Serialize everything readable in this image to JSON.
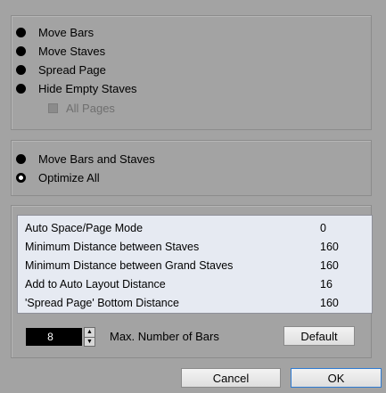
{
  "layout_options": [
    {
      "label": "Move Bars",
      "selected": true
    },
    {
      "label": "Move Staves",
      "selected": true
    },
    {
      "label": "Spread Page",
      "selected": true
    },
    {
      "label": "Hide Empty Staves",
      "selected": true
    }
  ],
  "all_pages": {
    "label": "All Pages",
    "checked": false,
    "enabled": false
  },
  "mode_options": [
    {
      "label": "Move Bars and Staves",
      "selected": true
    },
    {
      "label": "Optimize All",
      "selected": false
    }
  ],
  "parameters": [
    {
      "name": "Auto Space/Page Mode",
      "value": "0"
    },
    {
      "name": "Minimum Distance between Staves",
      "value": "160"
    },
    {
      "name": "Minimum Distance between Grand Staves",
      "value": "160"
    },
    {
      "name": "Add to Auto Layout Distance",
      "value": "16"
    },
    {
      "name": "'Spread Page' Bottom Distance",
      "value": "160"
    }
  ],
  "max_bars": {
    "value": "8",
    "label": "Max. Number of Bars"
  },
  "buttons": {
    "default": "Default",
    "cancel": "Cancel",
    "ok": "OK"
  }
}
